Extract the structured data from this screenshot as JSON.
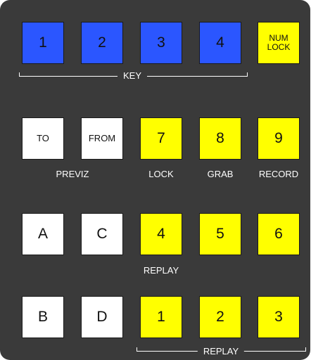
{
  "row_key": {
    "keys": [
      "1",
      "2",
      "3",
      "4"
    ],
    "numlock_line1": "NUM",
    "numlock_line2": "LOCK",
    "group_label": "KEY"
  },
  "row_previz": {
    "to": "TO",
    "from": "FROM",
    "n7": "7",
    "n8": "8",
    "n9": "9",
    "labels": {
      "previz": "PREVIZ",
      "lock": "LOCK",
      "grab": "GRAB",
      "record": "RECORD"
    }
  },
  "row_replay_mid": {
    "a": "A",
    "c": "C",
    "n4": "4",
    "n5": "5",
    "n6": "6",
    "label": "REPLAY"
  },
  "row_replay_bottom": {
    "b": "B",
    "d": "D",
    "n1": "1",
    "n2": "2",
    "n3": "3",
    "group_label": "REPLAY"
  },
  "colors": {
    "panel": "#3a3a3a",
    "blue": "#2b56ff",
    "yellow": "#ffff00",
    "white": "#ffffff"
  }
}
